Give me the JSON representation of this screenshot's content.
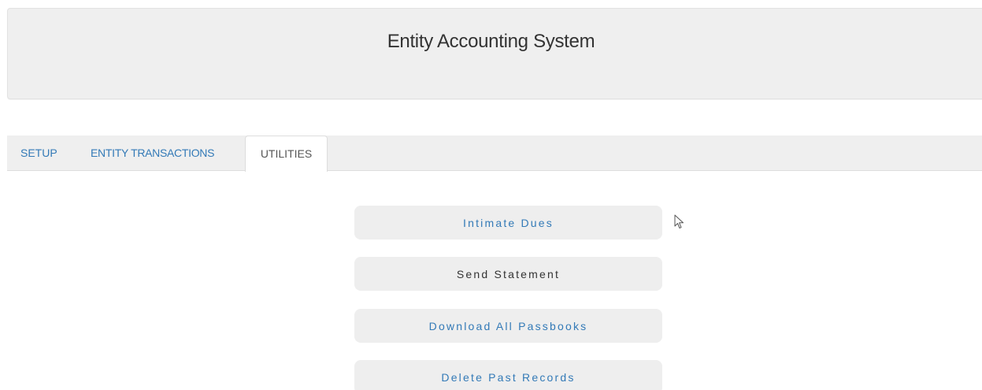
{
  "header": {
    "title": "Entity Accounting System"
  },
  "tabs": {
    "setup": "SETUP",
    "entity_transactions": "ENTITY TRANSACTIONS",
    "utilities": "UTILITIES",
    "active": "utilities"
  },
  "utilities": {
    "buttons": [
      {
        "label": "Intimate Dues"
      },
      {
        "label": "Send Statement"
      },
      {
        "label": "Download All Passbooks"
      },
      {
        "label": "Delete Past Records"
      }
    ]
  },
  "colors": {
    "link_blue": "#337ab7",
    "panel_gray": "#efefef",
    "text_dark": "#333333"
  },
  "icons": {
    "cursor": "mouse-pointer-icon"
  }
}
